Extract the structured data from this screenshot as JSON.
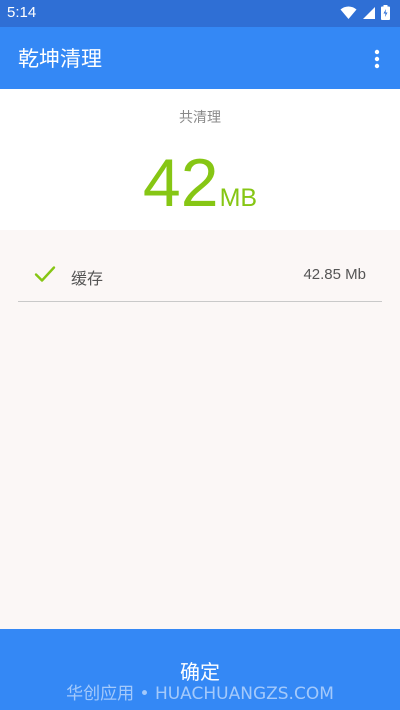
{
  "status_bar": {
    "time": "5:14",
    "icons": [
      "wifi-icon",
      "cell-signal-icon",
      "battery-icon"
    ]
  },
  "app_bar": {
    "title": "乾坤清理",
    "menu_icon": "more-vert-icon"
  },
  "summary": {
    "label": "共清理",
    "amount": "42",
    "unit": "MB",
    "amount_color": "#86c614"
  },
  "items": [
    {
      "label": "缓存",
      "value": "42.85 Mb",
      "icon": "check-icon",
      "checked": true
    }
  ],
  "confirm": {
    "label": "确定"
  },
  "watermark": {
    "text": "华创应用 • HUACHUANGZS.COM"
  },
  "colors": {
    "status_bar": "#2f6fd5",
    "app_bar": "#3488f5",
    "accent_green": "#86c614",
    "background": "#fbf7f6"
  }
}
